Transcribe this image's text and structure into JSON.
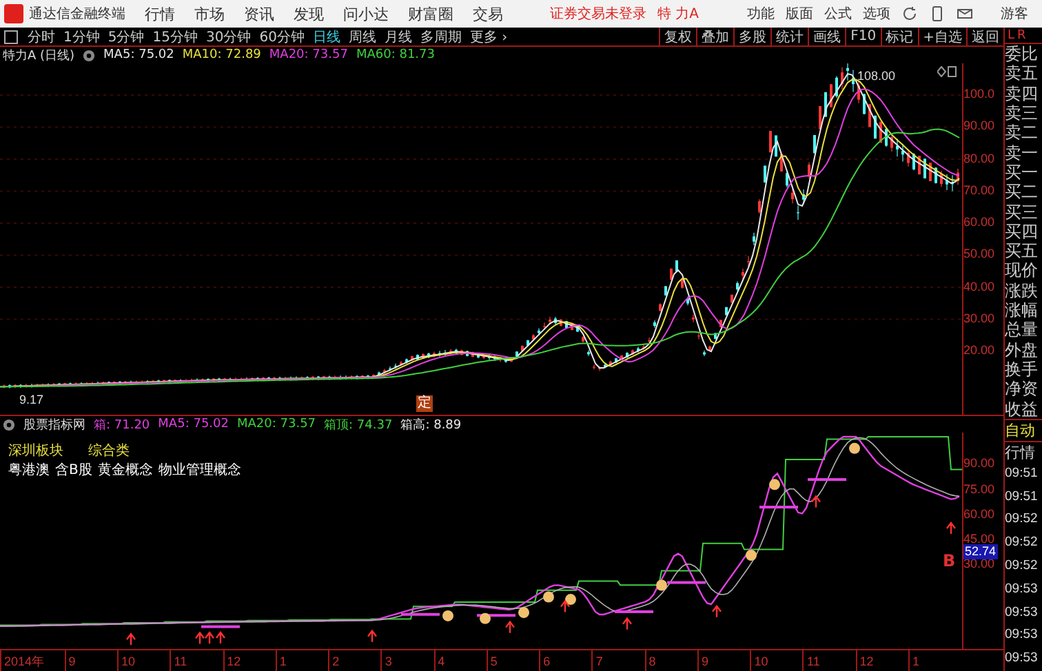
{
  "app": {
    "title": "通达信金融终端"
  },
  "menu": [
    "行情",
    "市场",
    "资讯",
    "发现",
    "问小达",
    "财富圈",
    "交易"
  ],
  "login_status": "证券交易未登录",
  "stock_name": "特 力A",
  "top_actions": [
    "功能",
    "版面",
    "公式",
    "选项"
  ],
  "user": "游客",
  "periods": [
    {
      "label": "分时",
      "selected": false
    },
    {
      "label": "1分钟",
      "selected": false
    },
    {
      "label": "5分钟",
      "selected": false
    },
    {
      "label": "15分钟",
      "selected": false
    },
    {
      "label": "30分钟",
      "selected": false
    },
    {
      "label": "60分钟",
      "selected": false
    },
    {
      "label": "日线",
      "selected": true
    },
    {
      "label": "周线",
      "selected": false
    },
    {
      "label": "月线",
      "selected": false
    },
    {
      "label": "多周期",
      "selected": false
    },
    {
      "label": "更多 ›",
      "selected": false
    }
  ],
  "chart_tools": [
    "复权",
    "叠加",
    "多股",
    "统计",
    "画线",
    "F10",
    "标记",
    "+自选",
    "返回"
  ],
  "main_chart": {
    "title": "特力A (日线)",
    "legend": [
      {
        "label": "MA5: 75.02",
        "color": "#e8e8e8"
      },
      {
        "label": "MA10: 72.89",
        "color": "#e8e040"
      },
      {
        "label": "MA20: 73.57",
        "color": "#e040e0"
      },
      {
        "label": "MA60: 81.73",
        "color": "#40d040"
      }
    ],
    "high_label": "108.00",
    "low_label": "9.17",
    "marker": "定",
    "y_axis": [
      "100.0",
      "90.00",
      "80.00",
      "70.00",
      "60.00",
      "50.00",
      "40.00",
      "30.00",
      "20.00"
    ]
  },
  "indicator": {
    "name": "股票指标网",
    "legend": [
      {
        "label": "箱: 71.20",
        "color": "#e040e0"
      },
      {
        "label": "MA5: 75.02",
        "color": "#e040e0"
      },
      {
        "label": "MA20: 73.57",
        "color": "#40d040"
      },
      {
        "label": "箱顶: 74.37",
        "color": "#40d040"
      },
      {
        "label": "箱高: 8.89",
        "color": "#e8e8e8"
      }
    ],
    "sector": [
      "深圳板块",
      "综合类"
    ],
    "concepts": [
      "粤港澳",
      "含B股",
      "黄金概念",
      "物业管理概念"
    ],
    "marker": "B",
    "y_axis": [
      "90.00",
      "75.00",
      "60.00",
      "45.00",
      "30.00"
    ],
    "current_value": "52.74"
  },
  "x_axis": [
    "2014年",
    "9",
    "10",
    "11",
    "12",
    "1",
    "2",
    "3",
    "4",
    "5",
    "6",
    "7",
    "8",
    "9",
    "10",
    "11",
    "12",
    "1"
  ],
  "quote_panel": {
    "header": [
      "L",
      "R"
    ],
    "fields": [
      "委比",
      "卖五",
      "卖四",
      "卖三",
      "卖二",
      "卖一",
      "买一",
      "买二",
      "买三",
      "买四",
      "买五",
      "现价",
      "涨跌",
      "涨幅",
      "总量",
      "外盘",
      "换手",
      "净资",
      "收益"
    ],
    "mode": [
      "自动",
      "行情"
    ],
    "times": [
      "09:51",
      "09:51",
      "09:52",
      "09:52",
      "09:52",
      "09:53",
      "09:53",
      "09:53",
      "09:53"
    ]
  }
}
